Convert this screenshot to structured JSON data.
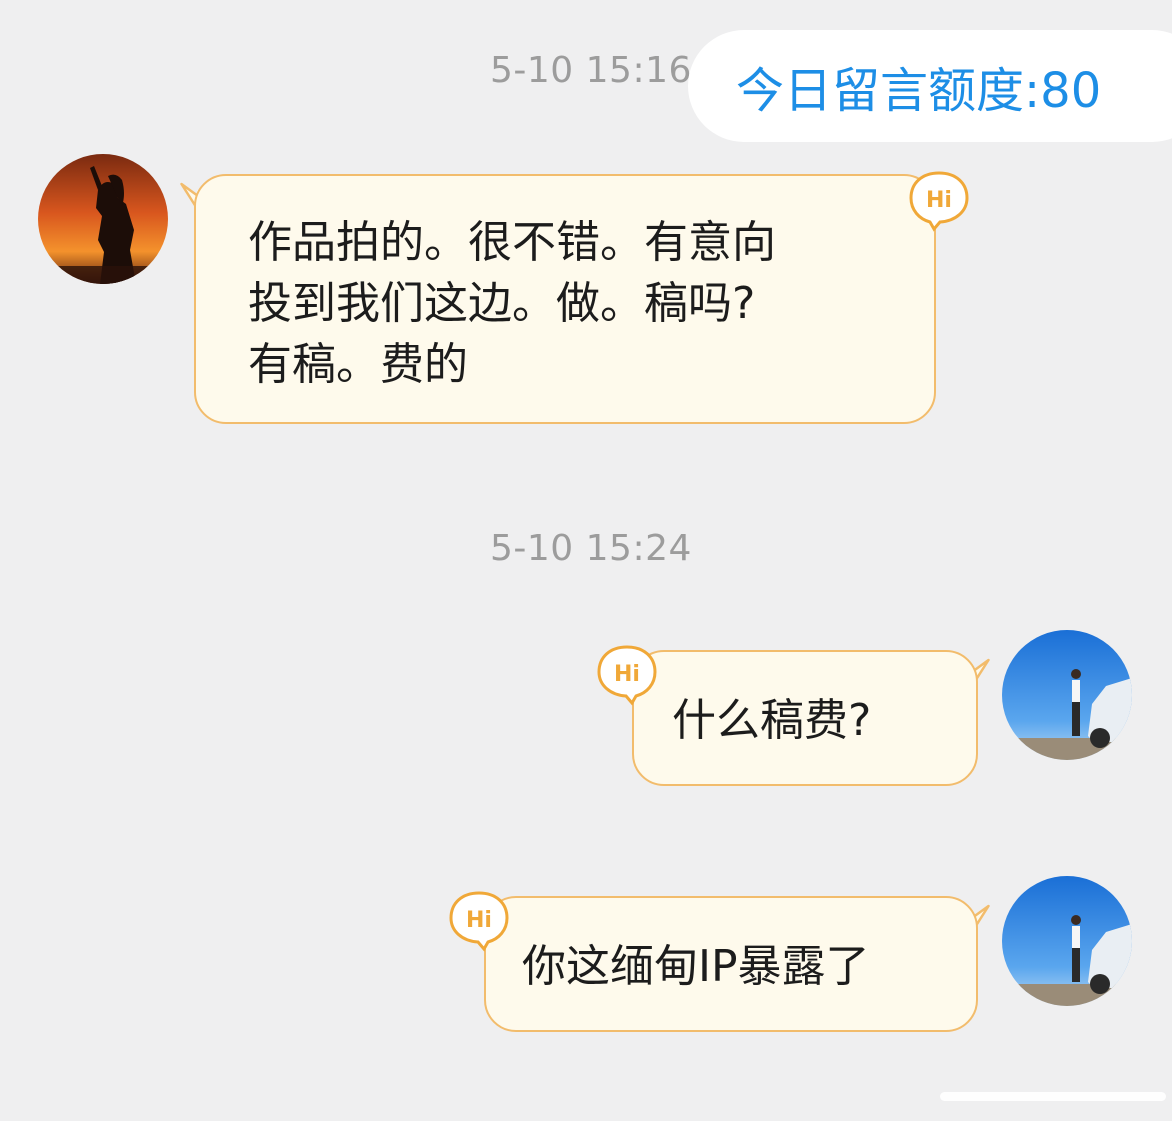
{
  "quota": {
    "label": "今日留言额度:80",
    "color": "#1d8ee6"
  },
  "messages": [
    {
      "timestamp": "5-10 15:16",
      "sender": "other",
      "text": "作品拍的。很不错。有意向\n投到我们这边。做。稿吗?\n有稿。费的",
      "badge": "Hi"
    },
    {
      "timestamp": "5-10 15:24",
      "sender": "self",
      "text": "什么稿费?",
      "badge": "Hi"
    },
    {
      "sender": "self",
      "text": "你这缅甸IP暴露了",
      "badge": "Hi"
    }
  ],
  "theme": {
    "background": "#efeff0",
    "bubble_fill": "#fefaec",
    "bubble_border": "#f2bc6c",
    "badge_color": "#f0a838",
    "timestamp_color": "#9c9c9c"
  }
}
